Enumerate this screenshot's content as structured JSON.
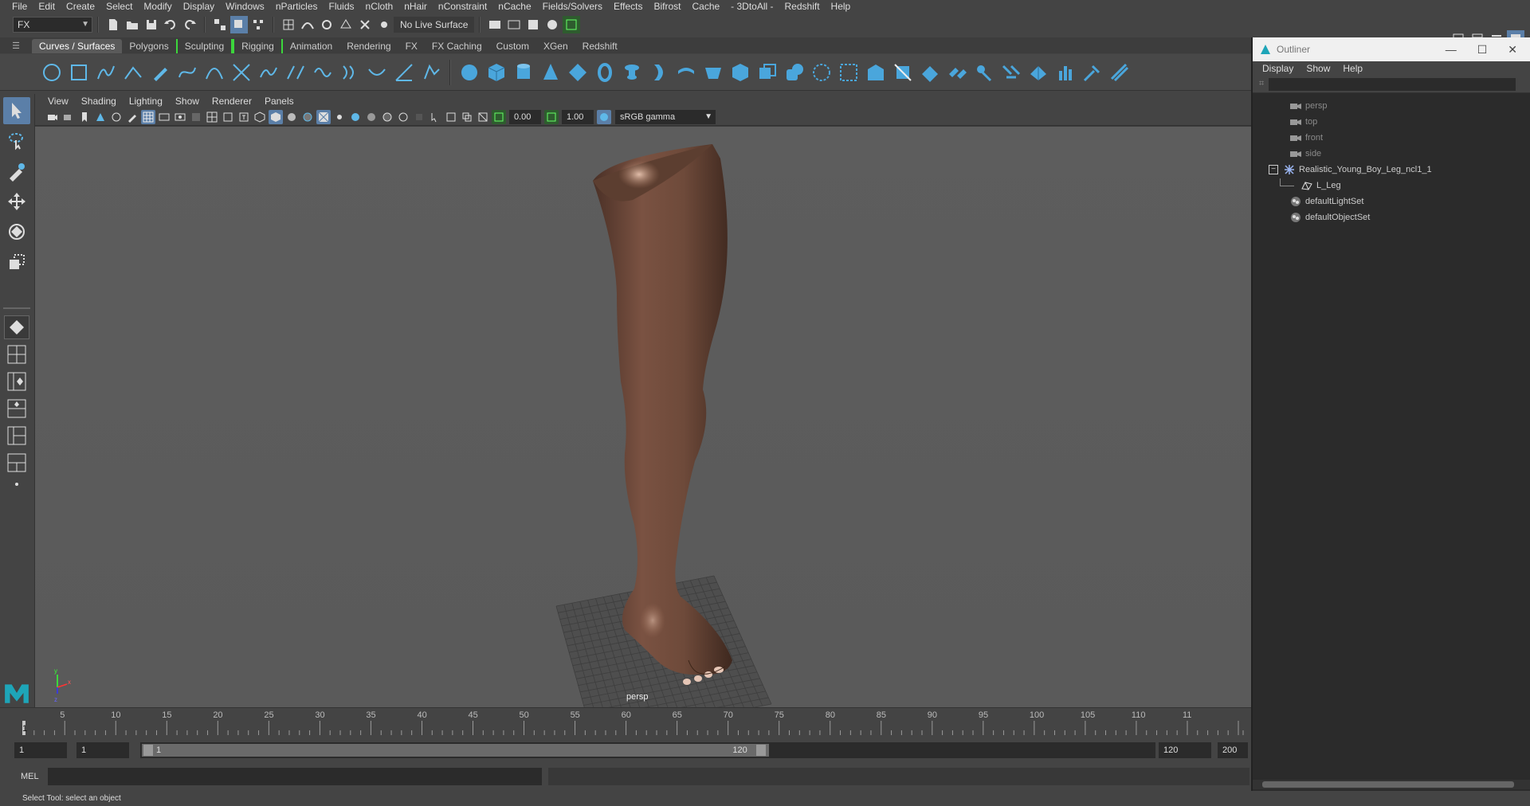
{
  "menubar": {
    "items": [
      "File",
      "Edit",
      "Create",
      "Select",
      "Modify",
      "Display",
      "Windows",
      "nParticles",
      "Fluids",
      "nCloth",
      "nHair",
      "nConstraint",
      "nCache",
      "Fields/Solvers",
      "Effects",
      "Bifrost",
      "Cache",
      "- 3DtoAll -",
      "Redshift",
      "Help"
    ]
  },
  "statusline": {
    "mode": "FX",
    "live_surface": "No Live Surface"
  },
  "shelf": {
    "tabs": [
      "Curves / Surfaces",
      "Polygons",
      "Sculpting",
      "Rigging",
      "Animation",
      "Rendering",
      "FX",
      "FX Caching",
      "Custom",
      "XGen",
      "Redshift"
    ],
    "active_tab": "Curves / Surfaces",
    "curve_icons": [
      "circle-icon",
      "square-icon",
      "cv-curve-icon",
      "ep-curve-icon",
      "pencil-curve-icon",
      "bezier-curve-icon",
      "arc-icon",
      "cut-curve-icon",
      "attach-curve-icon",
      "detach-curve-icon",
      "rebuild-curve-icon",
      "loft-icon",
      "sweep-icon",
      "planar-icon",
      "revolve-icon"
    ],
    "surface_icons": [
      "nurbs-sphere-icon",
      "nurbs-cube-icon",
      "nurbs-cylinder-icon",
      "nurbs-cone-icon",
      "nurbs-plane-icon",
      "nurbs-torus-icon",
      "revolve-surface-icon",
      "extrude-surface-icon",
      "loft-surface-icon",
      "birail-icon",
      "boundary-icon",
      "square-surface-icon",
      "bevel-icon",
      "intersect-icon",
      "project-curve-icon",
      "trim-icon",
      "untrim-icon",
      "attach-surface-icon",
      "detach-surface-icon",
      "align-icon",
      "open-close-icon",
      "rebuild-surface-icon",
      "sculpt-icon",
      "smooth-icon",
      "stitch-icon"
    ]
  },
  "viewport": {
    "menu": [
      "View",
      "Shading",
      "Lighting",
      "Show",
      "Renderer",
      "Panels"
    ],
    "exposure": "0.00",
    "gamma_value": "1.00",
    "color_space": "sRGB gamma",
    "camera_label": "persp",
    "model_colors": {
      "skin": "#6e4a3a",
      "skin_highlight": "#a87860",
      "grid": "#4a4a4a"
    }
  },
  "outliner": {
    "title": "Outliner",
    "menu": [
      "Display",
      "Show",
      "Help"
    ],
    "items": [
      {
        "label": "persp",
        "icon": "camera-icon",
        "dim": true,
        "indent": 0
      },
      {
        "label": "top",
        "icon": "camera-icon",
        "dim": true,
        "indent": 0
      },
      {
        "label": "front",
        "icon": "camera-icon",
        "dim": true,
        "indent": 0
      },
      {
        "label": "side",
        "icon": "camera-icon",
        "dim": true,
        "indent": 0
      },
      {
        "label": "Realistic_Young_Boy_Leg_ncl1_1",
        "icon": "group-icon",
        "dim": false,
        "indent": 0,
        "expanded": true
      },
      {
        "label": "L_Leg",
        "icon": "mesh-icon",
        "dim": false,
        "indent": 1
      },
      {
        "label": "defaultLightSet",
        "icon": "set-icon",
        "dim": false,
        "indent": 0
      },
      {
        "label": "defaultObjectSet",
        "icon": "set-icon",
        "dim": false,
        "indent": 0
      }
    ]
  },
  "timeline": {
    "ticks": [
      "1",
      "5",
      "10",
      "15",
      "20",
      "25",
      "30",
      "35",
      "40",
      "45",
      "50",
      "55",
      "60",
      "65",
      "70",
      "75",
      "80",
      "85",
      "90",
      "95",
      "100",
      "105",
      "110",
      "11"
    ],
    "current_frame": "1"
  },
  "range": {
    "start_field": "1",
    "current_field": "1",
    "range_start": "1",
    "range_end": "120",
    "end_field": "120",
    "max_field": "200"
  },
  "cmdline": {
    "label": "MEL"
  },
  "helpline": {
    "text": "Select Tool: select an object"
  }
}
